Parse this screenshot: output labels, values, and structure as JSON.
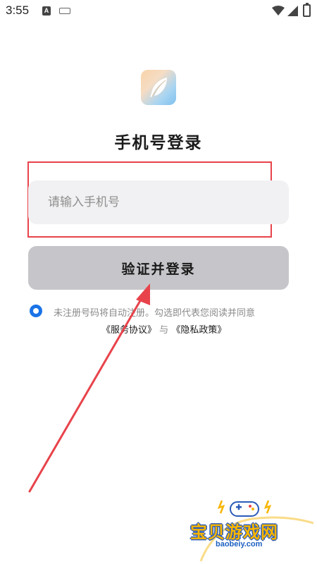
{
  "status_bar": {
    "time": "3:55",
    "icons": [
      "notification-a-icon",
      "keyboard-icon",
      "wifi-icon",
      "signal-icon",
      "battery-icon"
    ]
  },
  "app": {
    "logo_icon": "feather-icon",
    "title": "手机号登录"
  },
  "form": {
    "phone_placeholder": "请输入手机号",
    "phone_value": "",
    "submit_label": "验证并登录"
  },
  "agreement": {
    "checked": true,
    "line1": "未注册号码将自动注册。勾选即代表您阅读并同意",
    "service_link": "《服务协议》",
    "connector": "与",
    "privacy_link": "《隐私政策》"
  },
  "watermark": {
    "name": "宝贝游戏网",
    "url": "baobeiy.com"
  },
  "colors": {
    "accent": "#1a73e8",
    "annotation": "#e8434b",
    "button_bg": "#c6c6ca",
    "input_bg": "#f1f1f3"
  }
}
